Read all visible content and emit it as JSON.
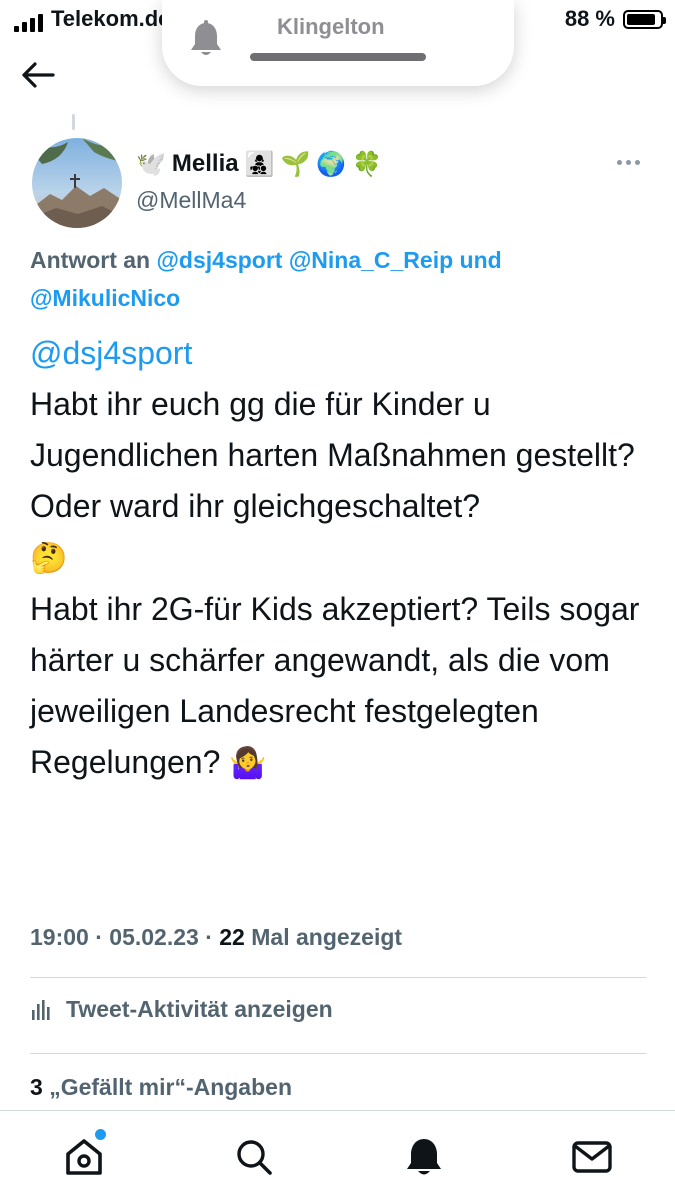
{
  "status_bar": {
    "carrier": "Telekom.de",
    "battery_percent": "88 %",
    "battery_level": 0.88
  },
  "ringer": {
    "label": "Klingelton",
    "icon": "bell-icon"
  },
  "tweet": {
    "author_name": "Mellia",
    "name_emojis": {
      "before": "🕊️",
      "after": [
        "👩‍👧‍👦",
        "🌱",
        "🌍",
        "🍀"
      ]
    },
    "handle": "@MellMa4",
    "reply_to": {
      "prefix": "Antwort an",
      "mentions": [
        "@dsj4sport",
        "@Nina_C_Reip"
      ],
      "conjunction": "und",
      "last_mention": "@MikulicNico"
    },
    "body": {
      "mention": "@dsj4sport",
      "paragraph1": "Habt ihr euch gg die für Kinder u Jugendlichen harten Maßnahmen gestellt? Oder ward ihr gleichgeschaltet?",
      "emoji1": "🤔",
      "paragraph2": "Habt ihr 2G-für Kids akzeptiert? Teils sogar härter u schärfer angewandt, als die vom jeweiligen Landesrecht festgelegten Regelungen?",
      "emoji2": "🤷‍♀️"
    },
    "time": "19:00",
    "date": "05.02.23",
    "views_count": "22",
    "views_label": "Mal angezeigt",
    "activity_label": "Tweet-Aktivität anzeigen",
    "likes_count": "3",
    "likes_label": "„Gefällt mir“-Angaben"
  },
  "nav": {
    "items": [
      "home-icon",
      "search-icon",
      "notifications-icon",
      "messages-icon"
    ]
  },
  "colors": {
    "accent": "#1d9bf0",
    "secondary_text": "#536471",
    "primary_text": "#0f1419"
  }
}
